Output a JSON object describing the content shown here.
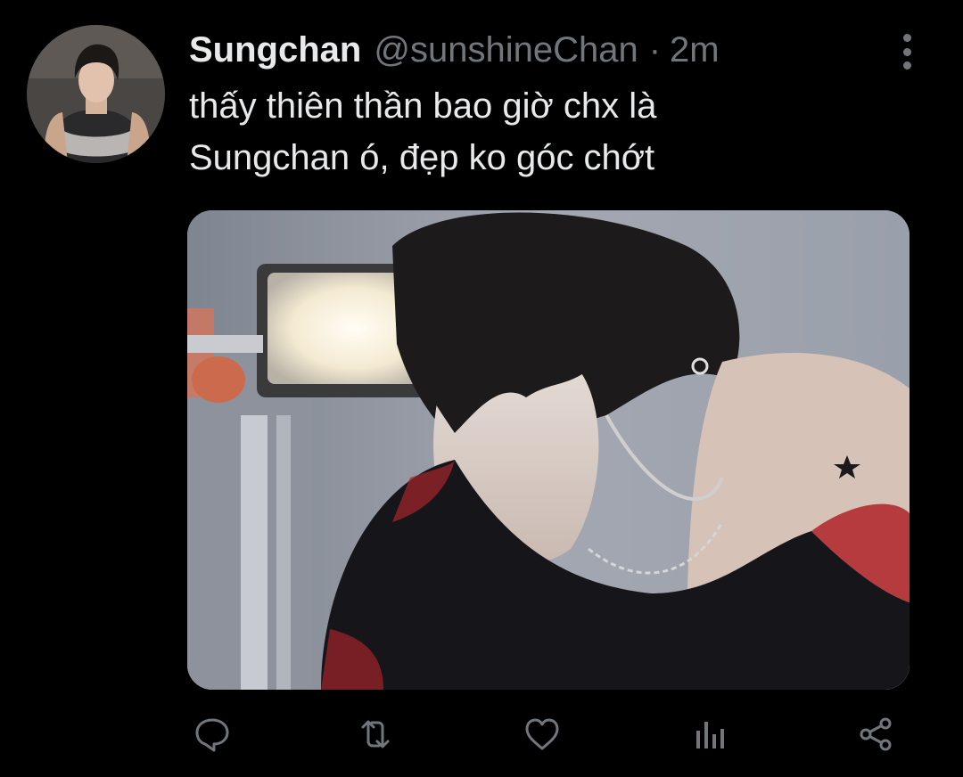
{
  "tweet": {
    "author": {
      "display_name": "Sungchan",
      "handle": "@sunshineChan",
      "avatar_icon": "user-avatar"
    },
    "separator": "·",
    "timestamp": "2m",
    "text_lines": [
      "thấy thiên thần bao giờ chx là",
      "Sungchan ó, đẹp ko góc chớt"
    ],
    "media": {
      "type": "photo"
    },
    "actions": [
      {
        "name": "reply",
        "icon": "reply-icon"
      },
      {
        "name": "retweet",
        "icon": "retweet-icon"
      },
      {
        "name": "like",
        "icon": "heart-icon"
      },
      {
        "name": "views",
        "icon": "analytics-icon"
      },
      {
        "name": "share",
        "icon": "share-icon"
      }
    ]
  },
  "colors": {
    "background": "#000000",
    "primary_text": "#e7e9ea",
    "secondary_text": "#71767b"
  }
}
